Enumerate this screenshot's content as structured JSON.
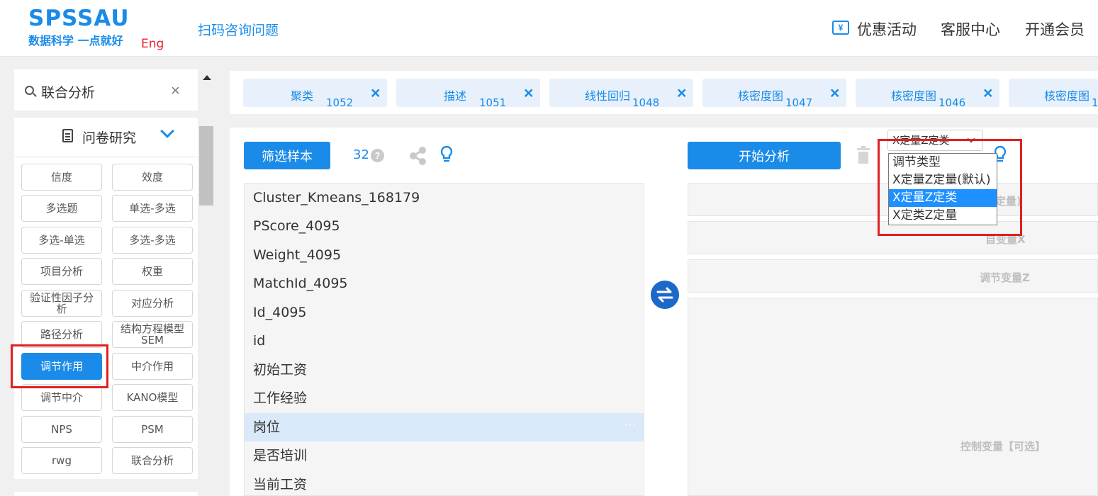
{
  "header": {
    "logo": "SPSSAU",
    "logo_sub": "数据科学 一点就好",
    "lang": "Eng",
    "scan_link": "扫码咨询问题",
    "coupon_icon_glyph": "¥",
    "nav": [
      "优惠活动",
      "客服中心",
      "开通会员"
    ]
  },
  "sidebar": {
    "search_value": "联合分析",
    "search_clear": "×",
    "category": "问卷研究",
    "methods": [
      "信度",
      "效度",
      "多选题",
      "单选-多选",
      "多选-单选",
      "多选-多选",
      "项目分析",
      "权重",
      "验证性因子分析",
      "对应分析",
      "路径分析",
      "结构方程模型SEM",
      "调节作用",
      "中介作用",
      "调节中介",
      "KANO模型",
      "NPS",
      "PSM",
      "rwg",
      "联合分析"
    ],
    "active_method": "调节作用"
  },
  "tabs": [
    {
      "label": "聚类",
      "count": "1052"
    },
    {
      "label": "描述",
      "count": "1051"
    },
    {
      "label": "线性回归",
      "count": "1048"
    },
    {
      "label": "核密度图",
      "count": "1047"
    },
    {
      "label": "核密度图",
      "count": "1046"
    },
    {
      "label": "核密度图",
      "count": "1"
    }
  ],
  "tab_close": "×",
  "left_panel": {
    "filter_button": "筛选样本",
    "count": "32",
    "help": "?",
    "variables": [
      "Cluster_Kmeans_168179",
      "PScore_4095",
      "Weight_4095",
      "MatchId_4095",
      "Id_4095",
      "id",
      "初始工资",
      "工作经验",
      "岗位",
      "是否培训",
      "当前工资"
    ],
    "selected_variable": "岗位",
    "more_dots": "···"
  },
  "right_panel": {
    "start_button": "开始分析",
    "select_value": "X定量Z定类",
    "dropdown_options": [
      "调节类型",
      "X定量Z定量(默认)",
      "X定量Z定类",
      "X定类Z定量"
    ],
    "highlighted_option": "X定量Z定类",
    "zones": {
      "y_label_visible": "定量)",
      "x_label": "自变量X",
      "z_label": "调节变量Z",
      "control_label": "控制变量【可选】"
    }
  },
  "colors": {
    "brand": "#1a8be8",
    "highlight": "#e02020",
    "selected_row": "#d9e9f9"
  }
}
